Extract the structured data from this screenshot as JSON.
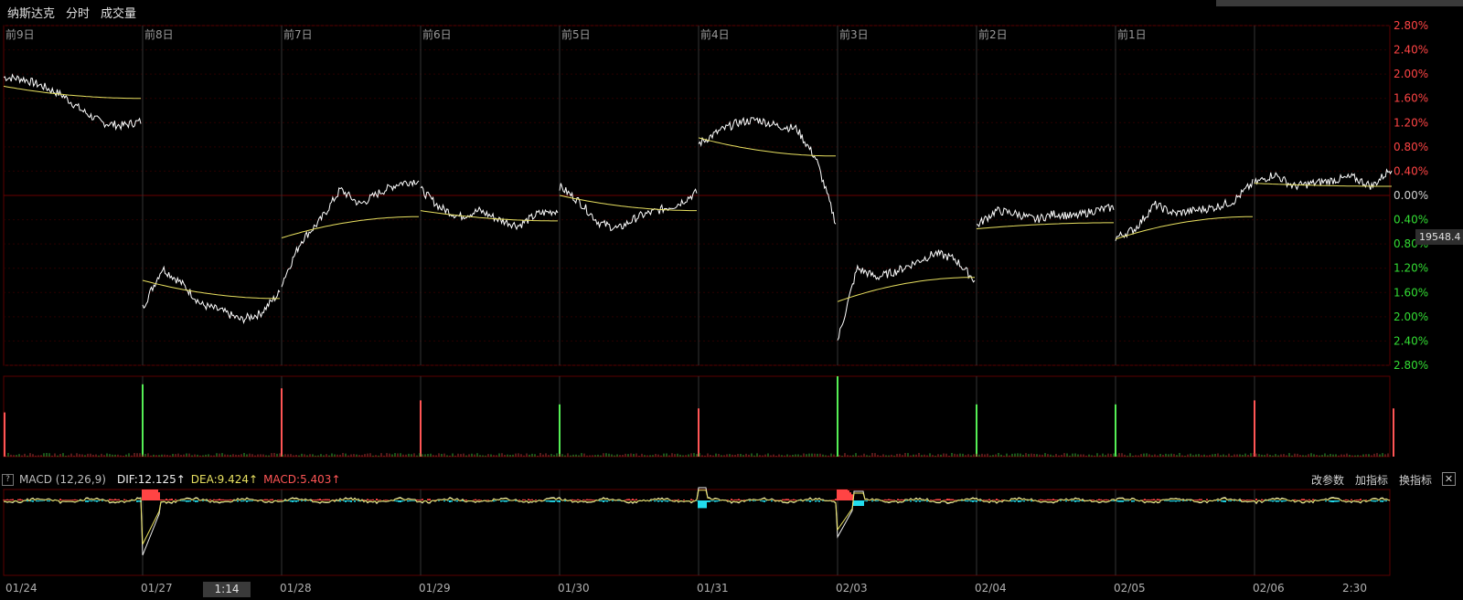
{
  "header": {
    "title": "纳斯达克",
    "tab_timeshare": "分时",
    "tab_volume": "成交量"
  },
  "chart_data": {
    "type": "line",
    "title": "纳斯达克",
    "day_labels": [
      "前9日",
      "前8日",
      "前7日",
      "前6日",
      "前5日",
      "前4日",
      "前3日",
      "前2日",
      "前1日"
    ],
    "date_labels": [
      "01/24",
      "01/27",
      "01/28",
      "01/29",
      "01/30",
      "01/31",
      "02/03",
      "02/04",
      "02/05",
      "02/06",
      "2:30"
    ],
    "y_axis_labels": [
      "2.80%",
      "2.40%",
      "2.00%",
      "1.60%",
      "1.20%",
      "0.80%",
      "0.40%",
      "0.00%",
      "0.40%",
      "0.80%",
      "1.20%",
      "1.60%",
      "2.00%",
      "2.40%",
      "2.80%"
    ],
    "ylim": [
      -2.8,
      2.8
    ],
    "series": [
      {
        "name": "price",
        "color": "#ffffff",
        "days": [
          [
            1.95,
            1.92,
            1.8,
            1.65,
            1.4,
            1.2,
            1.15,
            1.22
          ],
          [
            -1.85,
            -1.2,
            -1.45,
            -1.8,
            -1.9,
            -2.05,
            -1.95,
            -1.6
          ],
          [
            -1.45,
            -0.75,
            -0.4,
            0.1,
            -0.15,
            0.05,
            0.2,
            0.25
          ],
          [
            0.1,
            -0.2,
            -0.35,
            -0.25,
            -0.4,
            -0.5,
            -0.3,
            -0.25
          ],
          [
            0.15,
            -0.1,
            -0.45,
            -0.55,
            -0.35,
            -0.25,
            -0.15,
            0.05
          ],
          [
            0.85,
            1.05,
            1.2,
            1.25,
            1.15,
            1.1,
            0.6,
            -0.45
          ],
          [
            -2.4,
            -1.2,
            -1.35,
            -1.25,
            -1.1,
            -0.95,
            -1.05,
            -1.4
          ],
          [
            -0.5,
            -0.25,
            -0.3,
            -0.4,
            -0.3,
            -0.35,
            -0.25,
            -0.2
          ],
          [
            -0.7,
            -0.55,
            -0.15,
            -0.3,
            -0.25,
            -0.2,
            -0.1,
            0.2
          ],
          [
            0.2,
            0.35,
            0.15,
            0.2,
            0.25,
            0.3,
            0.15,
            0.45
          ]
        ]
      },
      {
        "name": "avg",
        "color": "#e8e060",
        "days": [
          [
            1.8,
            1.6
          ],
          [
            -1.4,
            -1.7
          ],
          [
            -0.7,
            -0.35
          ],
          [
            -0.25,
            -0.42
          ],
          [
            0.0,
            -0.25
          ],
          [
            0.95,
            0.65
          ],
          [
            -1.75,
            -1.35
          ],
          [
            -0.55,
            -0.45
          ],
          [
            -0.72,
            -0.35
          ],
          [
            0.2,
            0.15
          ]
        ]
      }
    ],
    "volume_spikes": [
      {
        "day": 0,
        "value": 0.55,
        "color": "#ff5555"
      },
      {
        "day": 1,
        "value": 0.9,
        "color": "#55ee55"
      },
      {
        "day": 2,
        "value": 0.85,
        "color": "#ff5555"
      },
      {
        "day": 3,
        "value": 0.7,
        "color": "#ff5555"
      },
      {
        "day": 4,
        "value": 0.65,
        "color": "#55ee55"
      },
      {
        "day": 5,
        "value": 0.6,
        "color": "#ff5555"
      },
      {
        "day": 6,
        "value": 1.0,
        "color": "#55ee55"
      },
      {
        "day": 7,
        "value": 0.65,
        "color": "#55ee55"
      },
      {
        "day": 8,
        "value": 0.65,
        "color": "#55ee55"
      },
      {
        "day": 9,
        "value": 0.7,
        "color": "#ff5555"
      },
      {
        "day": 10,
        "value": 0.6,
        "color": "#ff5555"
      }
    ],
    "macd_label": "MACD (12,26,9)",
    "dif_label": "DIF:12.125↑",
    "dea_label": "DEA:9.424↑",
    "macd_value_label": "MACD:5.403↑",
    "price_readout": "19548.4",
    "time_cursor": "1:14",
    "colors": {
      "up": "#ff4444",
      "down": "#22ddee",
      "grid": "#3a0000",
      "grid_day": "#2a2a2a",
      "dif": "#f0f0f0",
      "dea": "#e8e060"
    }
  },
  "macd_actions": {
    "change_params": "改参数",
    "add_indicator": "加指标",
    "switch_indicator": "换指标",
    "close": "✕"
  },
  "help_icon": "?"
}
